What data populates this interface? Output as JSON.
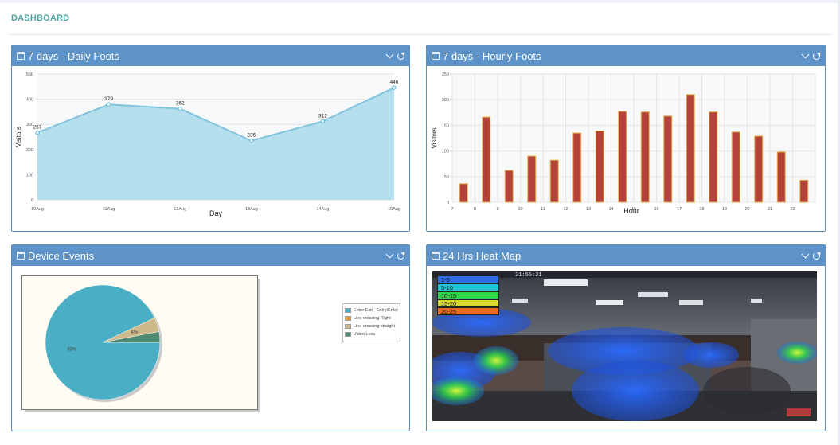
{
  "page": {
    "title": "DASHBOARD"
  },
  "panels": {
    "daily": {
      "title": "7 days - Daily Foots"
    },
    "hourly": {
      "title": "7 days - Hourly Foots"
    },
    "device": {
      "title": "Device Events"
    },
    "heatmap": {
      "title": "24 Hrs Heat Map"
    }
  },
  "heatmap_legend": {
    "ranges": [
      "1-5",
      "5-10",
      "10-15",
      "15-20",
      "20-25"
    ],
    "colors": [
      "#2f6fe0",
      "#21c4d6",
      "#2fd84a",
      "#d8d82a",
      "#e86a1e"
    ],
    "timestamp": "21:55:21"
  },
  "chart_data": [
    {
      "type": "area",
      "categories": [
        "10Aug",
        "11Aug",
        "12Aug",
        "13Aug",
        "14Aug",
        "15Aug"
      ],
      "values": [
        267,
        379,
        362,
        235,
        312,
        446
      ],
      "data_labels": [
        "267",
        "379",
        "362",
        "235",
        "312",
        "446"
      ],
      "xlabel": "Day",
      "ylabel": "Visitors",
      "ylim": [
        0,
        500
      ],
      "yticks": [
        0,
        100,
        200,
        300,
        400,
        500
      ],
      "fill_color": "#b5dfec",
      "line_color": "#7fc4dc",
      "grid": true
    },
    {
      "type": "bar",
      "categories": [
        "7",
        "8",
        "9",
        "10",
        "11",
        "12",
        "13",
        "14",
        "15",
        "16",
        "17",
        "18",
        "19",
        "20",
        "21",
        "22"
      ],
      "values": [
        36,
        166,
        62,
        90,
        82,
        135,
        139,
        177,
        176,
        168,
        210,
        176,
        137,
        129,
        98,
        43
      ],
      "xlabel": "Hour",
      "ylabel": "Visitors",
      "ylim": [
        0,
        250
      ],
      "yticks": [
        0,
        50,
        100,
        150,
        200,
        250
      ],
      "bar_color": "#b5433c",
      "bar_edge": "#e2b44a",
      "grid": true
    },
    {
      "type": "pie",
      "labels": [
        "Enter Exit - Entry/Enter",
        "Line crossing Right",
        "Line crossing straight",
        "Video Loss"
      ],
      "values": [
        93,
        0,
        4,
        3
      ],
      "data_labels": [
        "93%",
        "",
        "4%",
        ""
      ],
      "colors": [
        "#4aafc4",
        "#e89a2a",
        "#cdb98a",
        "#4e8a6e"
      ],
      "legend": "right"
    }
  ]
}
